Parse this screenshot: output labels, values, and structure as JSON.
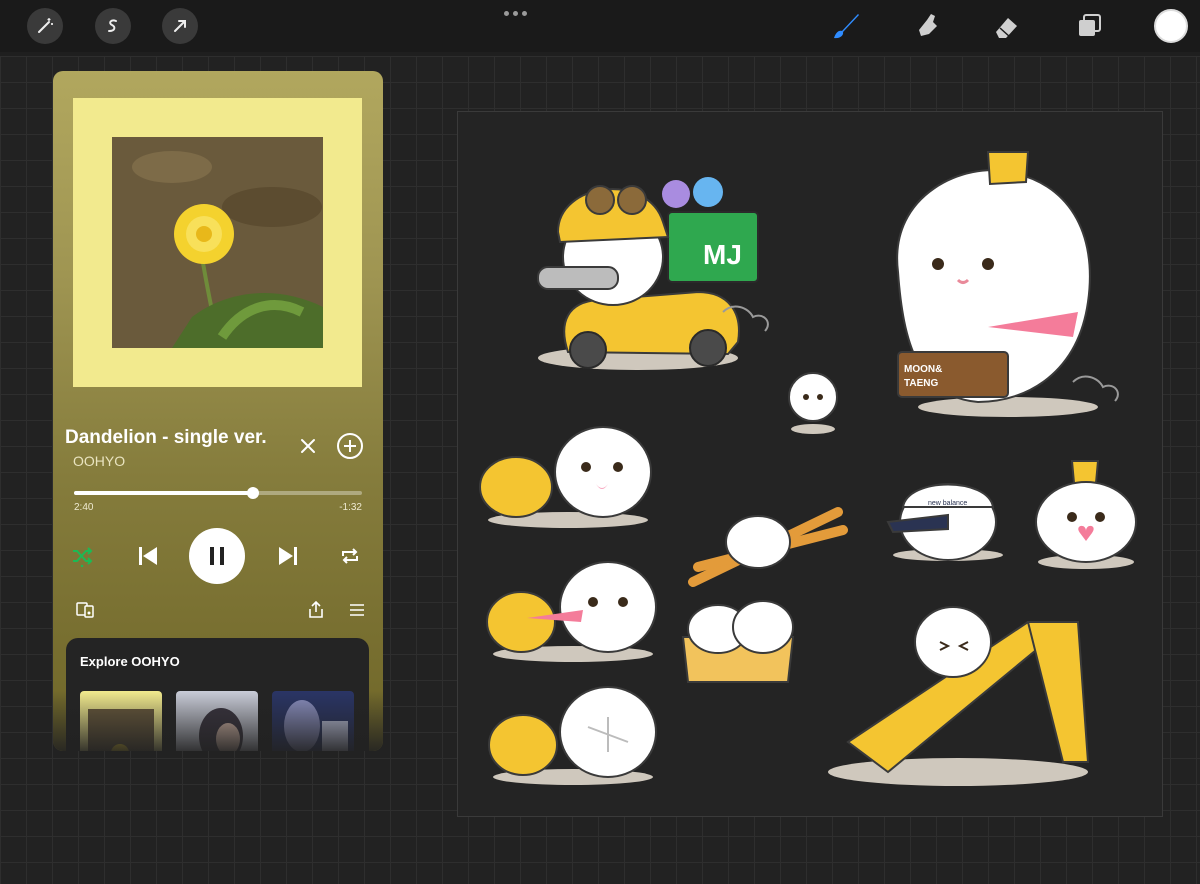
{
  "player": {
    "track_title": "Dandelion - single ver.",
    "artist": "OOHYO",
    "elapsed": "2:40",
    "remaining": "-1:32",
    "progress": 0.62,
    "explore_title": "Explore OOHYO",
    "shuffle_color": "#1db954"
  },
  "stickers": {
    "mj_box_label": "MJ",
    "moon_taeng_label": "MOON& TAENG",
    "cap_label": "new balance"
  },
  "colors": {
    "accent_brush": "#2f8cff",
    "frame_yellow": "#f2ea8e",
    "scooter_yellow": "#f4c531",
    "box_green": "#2fa84f"
  }
}
